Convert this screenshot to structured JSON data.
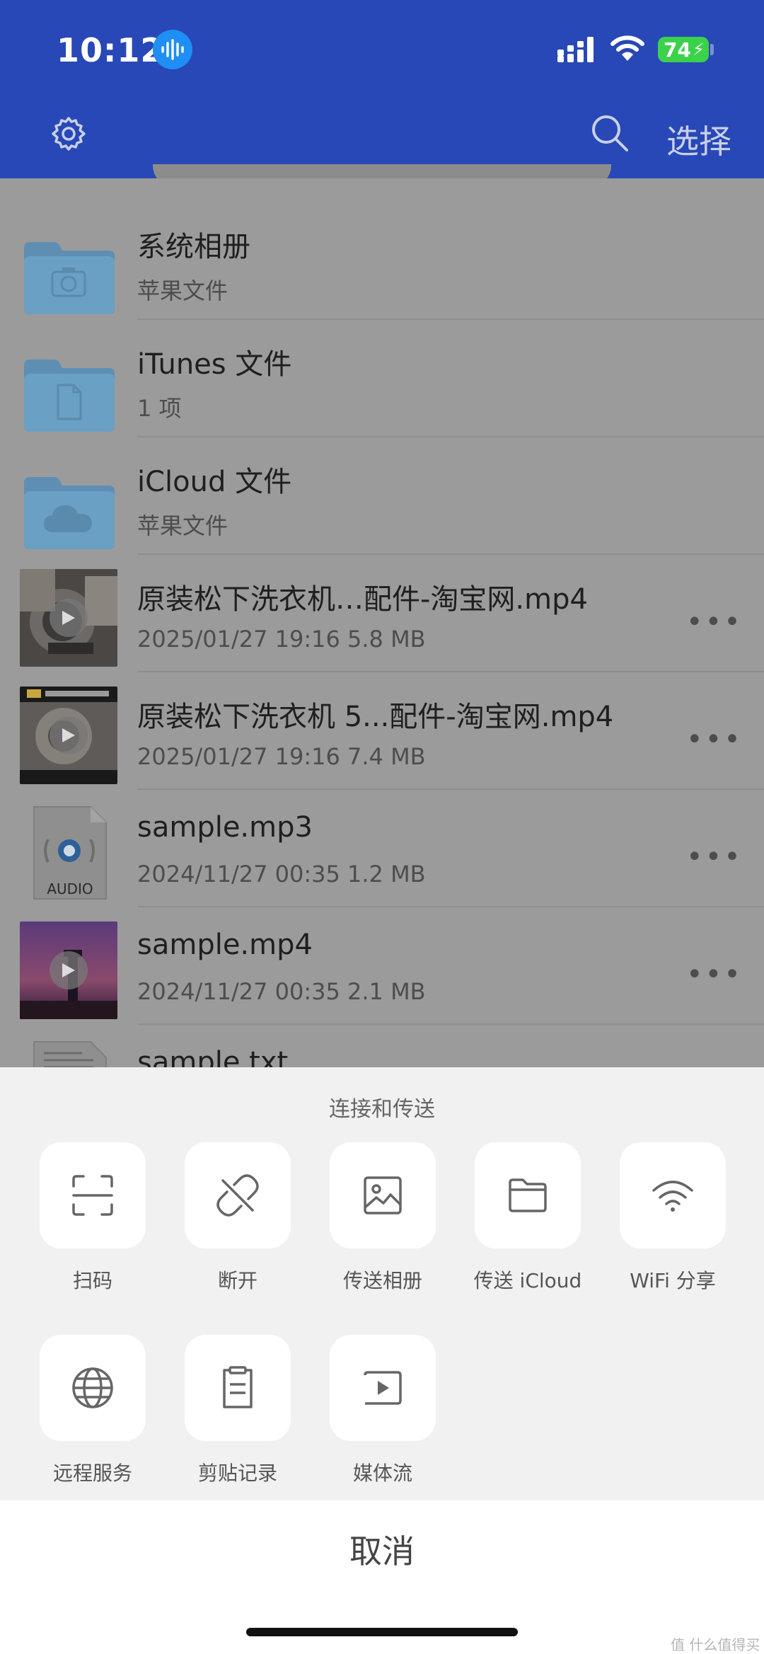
{
  "status": {
    "time": "10:12",
    "battery": "74"
  },
  "header": {
    "select_label": "选择"
  },
  "files": [
    {
      "name": "系统相册",
      "meta": "苹果文件",
      "type": "folder",
      "glyph": "camera"
    },
    {
      "name": "iTunes 文件",
      "meta": "1 项",
      "type": "folder",
      "glyph": "document"
    },
    {
      "name": "iCloud 文件",
      "meta": "苹果文件",
      "type": "folder",
      "glyph": "cloud"
    },
    {
      "name": "原装松下洗衣机…配件-淘宝网.mp4",
      "meta": "2025/01/27 19:16   5.8 MB",
      "type": "video",
      "more": "•••"
    },
    {
      "name": "原装松下洗衣机 5...配件-淘宝网.mp4",
      "meta": "2025/01/27 19:16   7.4 MB",
      "type": "video",
      "more": "•••"
    },
    {
      "name": "sample.mp3",
      "meta": "2024/11/27 00:35   1.2 MB",
      "type": "audio",
      "more": "•••",
      "badge": "AUDIO"
    },
    {
      "name": "sample.mp4",
      "meta": "2024/11/27 00:35   2.1 MB",
      "type": "video",
      "more": "•••"
    },
    {
      "name": "sample.txt",
      "meta": "",
      "type": "text"
    }
  ],
  "sheet": {
    "title": "连接和传送",
    "actions": [
      {
        "label": "扫码",
        "icon": "scan-icon"
      },
      {
        "label": "断开",
        "icon": "unlink-icon"
      },
      {
        "label": "传送相册",
        "icon": "image-icon"
      },
      {
        "label": "传送 iCloud",
        "icon": "folder-icon"
      },
      {
        "label": "WiFi 分享",
        "icon": "wifi-icon"
      },
      {
        "label": "远程服务",
        "icon": "globe-icon"
      },
      {
        "label": "剪贴记录",
        "icon": "clipboard-icon"
      },
      {
        "label": "媒体流",
        "icon": "media-play-icon"
      }
    ],
    "cancel_label": "取消"
  },
  "watermark": "值 什么值得买"
}
